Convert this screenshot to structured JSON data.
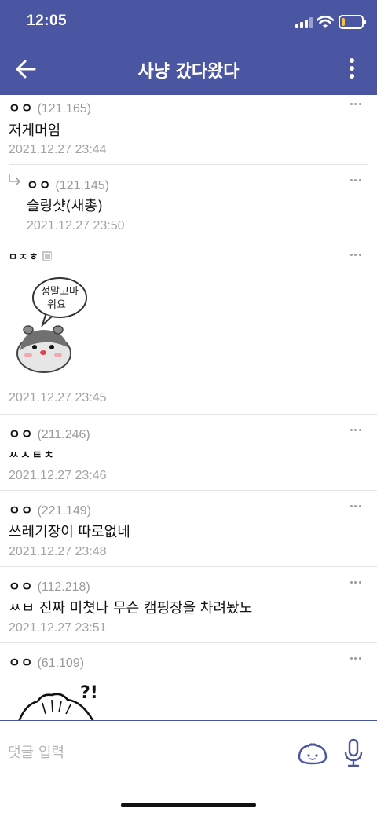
{
  "status_bar": {
    "time": "12:05",
    "battery_level_fraction": 0.15
  },
  "header": {
    "title": "사냥 갔다왔다"
  },
  "comments": [
    {
      "nick": "ㅇㅇ",
      "ip": "(121.165)",
      "text": "저게머임",
      "date": "2021.12.27 23:44"
    },
    {
      "nick": "ㅇㅇ",
      "ip": "(121.145)",
      "text": "슬링샷(새총)",
      "date": "2021.12.27 23:50",
      "is_reply": true
    },
    {
      "nick": "ㅁㅈㅎ",
      "ip": "",
      "text": "",
      "sticker_text_1": "정말고마",
      "sticker_text_2": "워요",
      "date": "2021.12.27 23:45"
    },
    {
      "nick": "ㅇㅇ",
      "ip": "(211.246)",
      "text": "ㅆㅅㅌㅊ",
      "date": "2021.12.27 23:46"
    },
    {
      "nick": "ㅇㅇ",
      "ip": "(221.149)",
      "text": "쓰레기장이 따로없네",
      "date": "2021.12.27 23:48"
    },
    {
      "nick": "ㅇㅇ",
      "ip": "(112.218)",
      "text": "ㅆㅂ 진짜 미쳣나 무슨 캠핑장을 차려놨노",
      "date": "2021.12.27 23:51"
    },
    {
      "nick": "ㅇㅇ",
      "ip": "(61.109)",
      "text": "",
      "sticker_text_1": "?!",
      "date": ""
    }
  ],
  "input": {
    "placeholder": "댓글 입력"
  },
  "icons": {
    "back": "arrow-left-icon",
    "menu": "more-vertical-icon",
    "comment_menu": "more-horizontal-icon",
    "reply": "reply-arrow-icon",
    "emoji": "dumpling-emoji-icon",
    "mic": "microphone-icon"
  },
  "colors": {
    "primary": "#4b56a3",
    "text": "#111111",
    "muted": "#a3a3a3",
    "divider": "#e3e3e3"
  }
}
